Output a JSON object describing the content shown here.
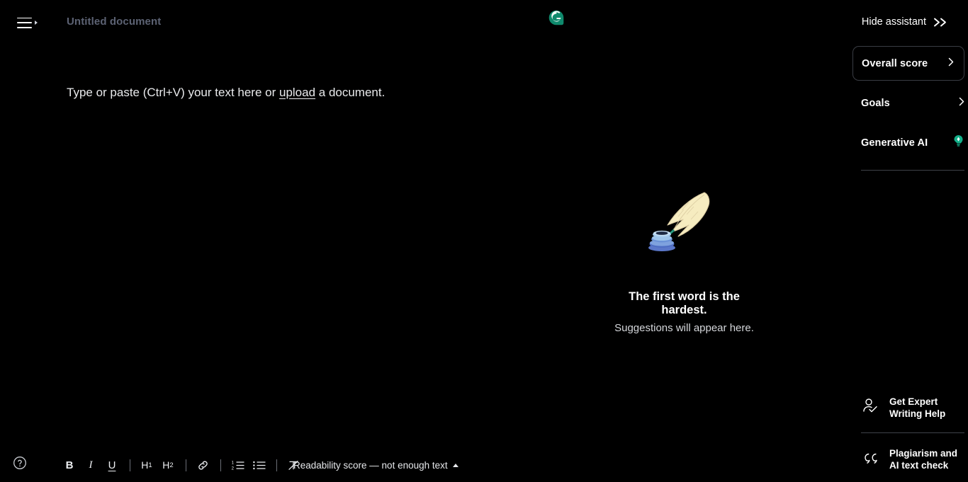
{
  "app": {
    "name": "Grammarly Editor",
    "background": "#000000",
    "accent": "#0d8a6a"
  },
  "topbar": {
    "menu_icon": "hamburger-menu-icon",
    "menu_caret_icon": "caret-right-icon",
    "document_title": "Untitled document",
    "logo_icon": "grammarly-logo-icon",
    "logo_letter": "G",
    "hide_assistant_label": "Hide assistant",
    "hide_assistant_icon": "double-chevron-right-icon"
  },
  "editor": {
    "placeholder_before": "Type or paste (Ctrl+V) your text here or ",
    "upload_link": "upload",
    "placeholder_after": " a document."
  },
  "empty_state": {
    "illustration": "quill-and-inkwell-icon",
    "title": "The first word is the hardest.",
    "subtitle": "Suggestions will appear here."
  },
  "assistant_panel": {
    "overall_score": {
      "label": "Overall score",
      "chevron_icon": "chevron-right-icon"
    },
    "rows": [
      {
        "label": "Goals",
        "icon": "chevron-right-icon",
        "name": "goals"
      },
      {
        "label": "Generative AI",
        "icon": "lightbulb-icon",
        "name": "generative-ai"
      }
    ],
    "cta": [
      {
        "label_line1": "Get Expert",
        "label_line2": "Writing Help",
        "icon": "person-check-icon",
        "name": "get-expert-writing-help"
      },
      {
        "label_line1": "Plagiarism and",
        "label_line2": "AI text check",
        "icon": "quotation-mark-icon",
        "name": "plagiarism-ai-check"
      }
    ]
  },
  "bottom_toolbar": {
    "help_icon": "help-circle-icon",
    "tools": [
      {
        "label": "B",
        "name": "bold-button",
        "kind": "b"
      },
      {
        "label": "I",
        "name": "italic-button",
        "kind": "i"
      },
      {
        "label": "U",
        "name": "underline-button",
        "kind": "u"
      },
      {
        "label": "H",
        "sub": "1",
        "name": "heading-1-button",
        "kind": "h"
      },
      {
        "label": "H",
        "sub": "2",
        "name": "heading-2-button",
        "kind": "h"
      },
      {
        "label": "link",
        "name": "link-button",
        "kind": "icon"
      },
      {
        "label": "numbered-list",
        "name": "numbered-list-button",
        "kind": "icon"
      },
      {
        "label": "bulleted-list",
        "name": "bulleted-list-button",
        "kind": "icon"
      },
      {
        "label": "clear-formatting",
        "name": "clear-formatting-button",
        "kind": "icon"
      }
    ],
    "readability_text": "Readability score — not enough text",
    "readability_caret_icon": "caret-up-icon"
  }
}
